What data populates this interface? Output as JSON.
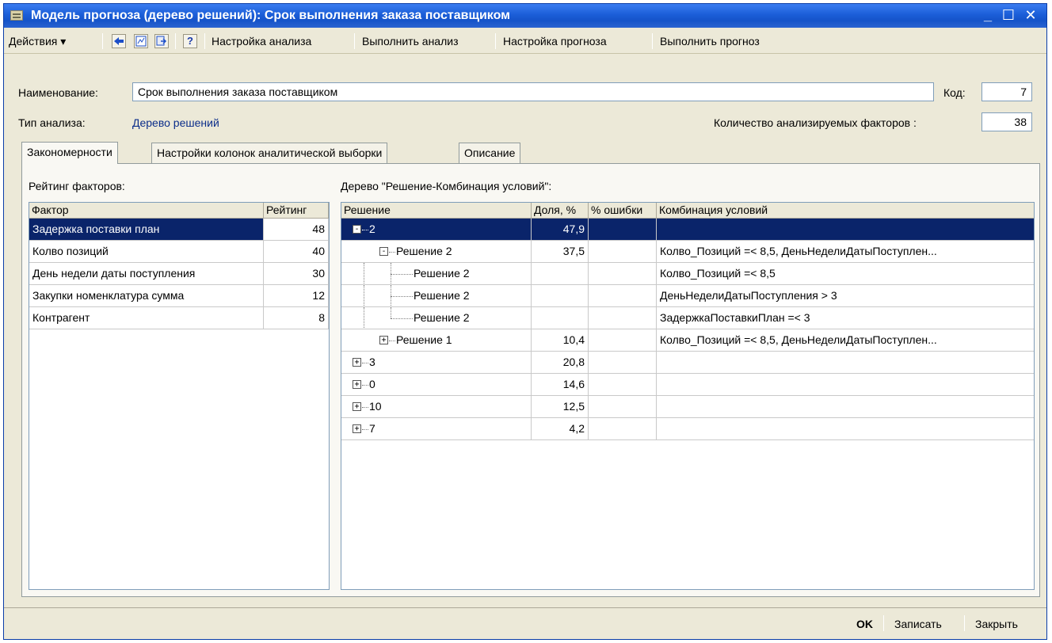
{
  "window": {
    "title": "Модель прогноза (дерево решений): Срок выполнения заказа поставщиком",
    "min": "_",
    "max": "☐",
    "close": "✕"
  },
  "toolbar": {
    "actions_label": "Действия ▾",
    "icons": [
      "back-arrow-icon",
      "chart-icon",
      "export-icon",
      "help-icon"
    ],
    "help_glyph": "?",
    "items": [
      "Настройка анализа",
      "Выполнить анализ",
      "Настройка прогноза",
      "Выполнить прогноз"
    ]
  },
  "form": {
    "name_label": "Наименование:",
    "name_value": "Срок выполнения заказа поставщиком",
    "code_label": "Код:",
    "code_value": "7",
    "type_label": "Тип анализа:",
    "type_value": "Дерево решений",
    "factors_label": "Количество анализируемых факторов :",
    "factors_value": "38"
  },
  "tabs": [
    "Закономерности",
    "Настройки колонок аналитической выборки",
    "Описание"
  ],
  "factors_panel": {
    "title": "Рейтинг факторов:",
    "columns": [
      "Фактор",
      "Рейтинг"
    ],
    "rows": [
      {
        "factor": "Задержка поставки план",
        "rating": "48"
      },
      {
        "factor": "Колво позиций",
        "rating": "40"
      },
      {
        "factor": "День недели даты поступления",
        "rating": "30"
      },
      {
        "factor": "Закупки номенклатура сумма",
        "rating": "12"
      },
      {
        "factor": "Контрагент",
        "rating": "8"
      }
    ]
  },
  "tree_panel": {
    "title": "Дерево \"Решение-Комбинация условий\":",
    "columns": [
      "Решение",
      "Доля, %",
      "% ошибки",
      "Комбинация условий"
    ],
    "rows": [
      {
        "label": "2",
        "share": "47,9",
        "err": "",
        "cond": ""
      },
      {
        "label": "Решение 2",
        "share": "37,5",
        "err": "",
        "cond": "Колво_Позиций =< 8,5, ДеньНеделиДатыПоступлен..."
      },
      {
        "label": "Решение 2",
        "share": "",
        "err": "",
        "cond": "Колво_Позиций =< 8,5"
      },
      {
        "label": "Решение 2",
        "share": "",
        "err": "",
        "cond": "ДеньНеделиДатыПоступления > 3"
      },
      {
        "label": "Решение 2",
        "share": "",
        "err": "",
        "cond": "ЗадержкаПоставкиПлан =< 3"
      },
      {
        "label": "Решение 1",
        "share": "10,4",
        "err": "",
        "cond": "Колво_Позиций =< 8,5, ДеньНеделиДатыПоступлен..."
      },
      {
        "label": "3",
        "share": "20,8",
        "err": "",
        "cond": ""
      },
      {
        "label": "0",
        "share": "14,6",
        "err": "",
        "cond": ""
      },
      {
        "label": "10",
        "share": "12,5",
        "err": "",
        "cond": ""
      },
      {
        "label": "7",
        "share": "4,2",
        "err": "",
        "cond": ""
      }
    ]
  },
  "footer": {
    "ok": "OK",
    "save": "Записать",
    "close": "Закрыть"
  }
}
